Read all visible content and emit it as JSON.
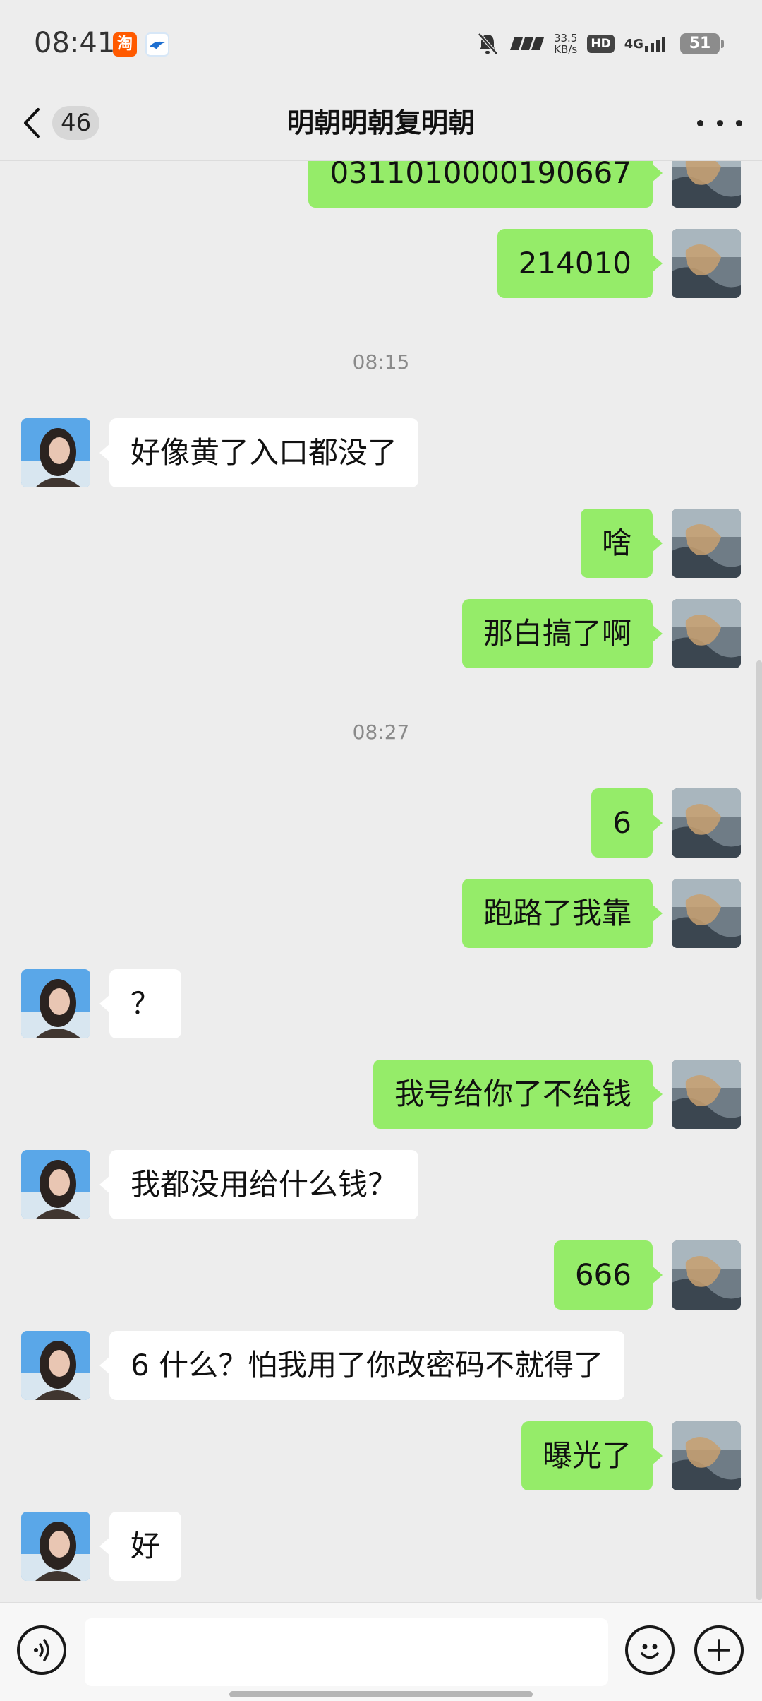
{
  "status_bar": {
    "time": "08:41",
    "app_icons": [
      "taobao-icon",
      "bird-icon"
    ],
    "speed_value": "33.5",
    "speed_unit": "KB/s",
    "hd": "HD",
    "network": "4G",
    "battery": "51"
  },
  "header": {
    "badge": "46",
    "title": "明朝明朝复明朝"
  },
  "messages": [
    {
      "side": "mine",
      "text": "0311010000190667"
    },
    {
      "side": "mine",
      "text": "214010"
    },
    {
      "side": "time",
      "text": "08:15"
    },
    {
      "side": "theirs",
      "text": "好像黄了入口都没了"
    },
    {
      "side": "mine",
      "text": "啥"
    },
    {
      "side": "mine",
      "text": "那白搞了啊"
    },
    {
      "side": "time",
      "text": "08:27"
    },
    {
      "side": "mine",
      "text": "6"
    },
    {
      "side": "mine",
      "text": "跑路了我靠"
    },
    {
      "side": "theirs",
      "text": "？"
    },
    {
      "side": "mine",
      "text": "我号给你了不给钱"
    },
    {
      "side": "theirs",
      "text": "我都没用给什么钱？"
    },
    {
      "side": "mine",
      "text": "666"
    },
    {
      "side": "theirs",
      "text": "6 什么？怕我用了你改密码不就得了"
    },
    {
      "side": "mine",
      "text": "曝光了"
    },
    {
      "side": "theirs",
      "text": "好"
    }
  ],
  "input": {
    "value": "",
    "voice_icon": "voice-icon",
    "emoji_icon": "emoji-icon",
    "plus_icon": "plus-icon"
  },
  "colors": {
    "mine_bubble": "#95ec69",
    "theirs_bubble": "#ffffff",
    "background": "#ededed"
  }
}
